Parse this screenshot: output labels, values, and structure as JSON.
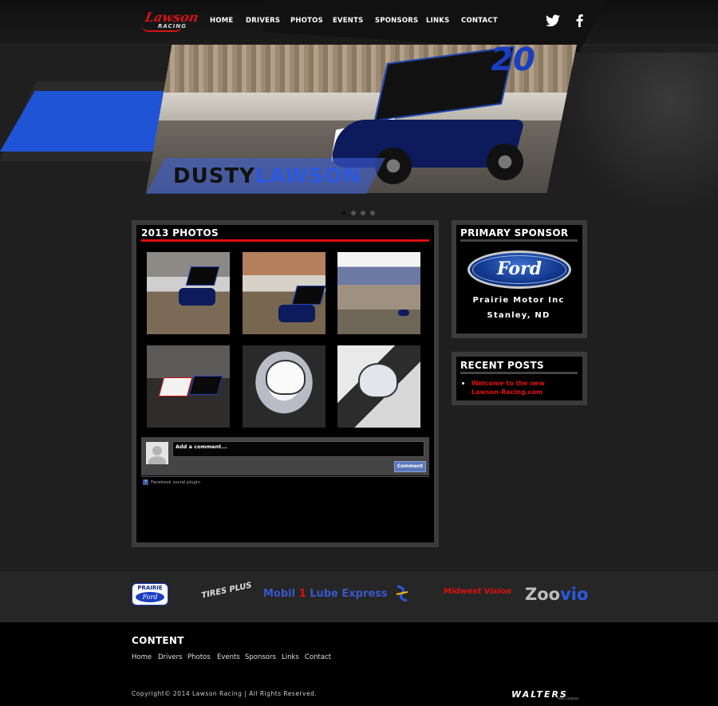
{
  "site": {
    "logo_top": "Lawson",
    "logo_bottom": "RACING"
  },
  "nav": {
    "items": [
      "HOME",
      "DRIVERS",
      "PHOTOS",
      "EVENTS",
      "SPONSORS",
      "LINKS",
      "CONTACT"
    ],
    "social": [
      "twitter-icon",
      "facebook-icon"
    ]
  },
  "hero": {
    "first_name": "DUSTY",
    "last_name": "LAWSON",
    "car_number": "20",
    "slides": 4,
    "active_slide": 1
  },
  "photos": {
    "title": "2013 PHOTOS",
    "thumbnails": [
      "photo-1",
      "photo-2",
      "photo-3",
      "photo-4",
      "photo-5",
      "photo-6"
    ]
  },
  "comments": {
    "placeholder": "Add a comment...",
    "button": "Comment",
    "plugin_label": "Facebook social plugin"
  },
  "primary_sponsor": {
    "title": "PRIMARY SPONSOR",
    "brand": "Ford",
    "line1": "Prairie Motor Inc",
    "line2": "Stanley, ND"
  },
  "recent_posts": {
    "title": "RECENT POSTS",
    "items": [
      "Welcome to the new Lawson-Racing.com"
    ]
  },
  "sponsor_strip": {
    "prairie_top": "PRAIRIE",
    "prairie_bottom": "Ford",
    "tires_plus": "TIRES PLUS",
    "mobil_a": "Mobil ",
    "mobil_one": "1",
    "mobil_b": " Lube Express",
    "midwest": "Midwest Vision",
    "zoovio_a": "Zoo",
    "zoovio_b": "vio"
  },
  "footer": {
    "title": "CONTENT",
    "links": [
      "Home",
      "Drivers",
      "Photos",
      "Events",
      "Sponsors",
      "Links",
      "Contact"
    ],
    "copyright": "Copyright© 2014 Lawson Racing | All Rights Reserved.",
    "credit": "WALTERS",
    "credit_sub": "Web Creation"
  },
  "colors": {
    "accent_red": "#e01010",
    "accent_blue": "#1f54d6",
    "background": "#1f1f1f"
  }
}
